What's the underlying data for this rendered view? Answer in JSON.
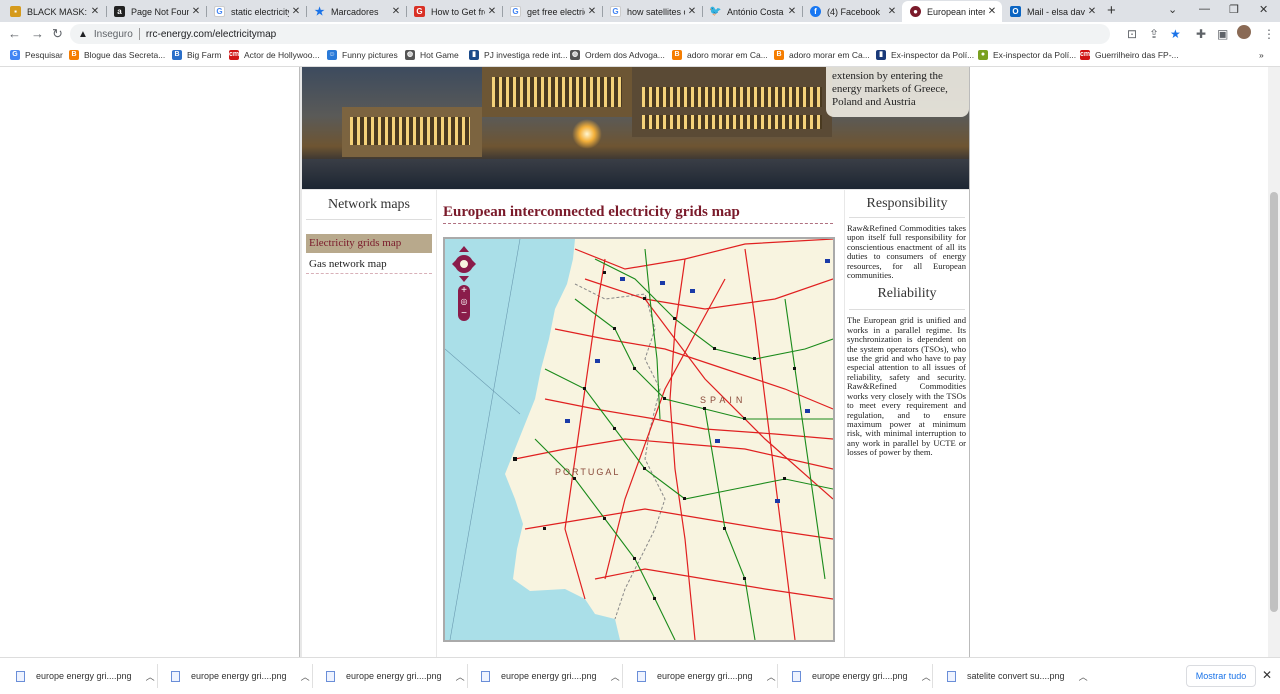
{
  "tabs": [
    {
      "title": "BLACK MASK: Su",
      "favicon": "film-icon",
      "color": "#d59a1c"
    },
    {
      "title": "Page Not Found",
      "favicon": "amazon-icon",
      "color": "#222222"
    },
    {
      "title": "static electricity",
      "favicon": "google-icon",
      "color": "#4285f4"
    },
    {
      "title": "Marcadores",
      "favicon": "star-icon",
      "color": "#1a73e8"
    },
    {
      "title": "How to Get free",
      "favicon": "red-square-icon",
      "color": "#d93025"
    },
    {
      "title": "get free electric",
      "favicon": "google-icon",
      "color": "#4285f4"
    },
    {
      "title": "how satellites co",
      "favicon": "google-icon",
      "color": "#4285f4"
    },
    {
      "title": "António Costa n",
      "favicon": "twitter-icon",
      "color": "#1d9bf0"
    },
    {
      "title": "(4) Facebook",
      "favicon": "facebook-icon",
      "color": "#1877f2"
    },
    {
      "title": "European interc",
      "favicon": "site-icon",
      "color": "#7a1a2a",
      "active": true
    },
    {
      "title": "Mail - elsa davi",
      "favicon": "outlook-icon",
      "color": "#0a64c2"
    }
  ],
  "address": {
    "security": "Inseguro",
    "url": "rrc-energy.com/electricitymap"
  },
  "bookmarks": [
    {
      "label": "Pesquisar",
      "icon": "google-icon",
      "color": "#4285f4"
    },
    {
      "label": "Blogue das Secreta...",
      "icon": "blogger-icon",
      "color": "#f57d00"
    },
    {
      "label": "Big Farm",
      "icon": "bigfarm-icon",
      "color": "#2a6fc9"
    },
    {
      "label": "Actor de Hollywoo...",
      "icon": "cm-icon",
      "color": "#d01414"
    },
    {
      "label": "Funny pictures",
      "icon": "funny-icon",
      "color": "#2a7ad8"
    },
    {
      "label": "Hot Game",
      "icon": "globe-icon",
      "color": "#555555"
    },
    {
      "label": "PJ investiga rede int...",
      "icon": "news-icon",
      "color": "#1a4a8a"
    },
    {
      "label": "Ordem dos Advoga...",
      "icon": "globe-icon",
      "color": "#555555"
    },
    {
      "label": "adoro morar em Ca...",
      "icon": "blogger-icon",
      "color": "#f57d00"
    },
    {
      "label": "adoro morar em Ca...",
      "icon": "blogger-icon",
      "color": "#f57d00"
    },
    {
      "label": "Ex-inspector da Polí...",
      "icon": "news-icon",
      "color": "#1a3a7a"
    },
    {
      "label": "Ex-inspector da Polí...",
      "icon": "frog-icon",
      "color": "#7aa020"
    },
    {
      "label": "Guerrilheiro das FP-...",
      "icon": "cm-icon",
      "color": "#d01414"
    }
  ],
  "banner": {
    "caption": "extension by entering the energy markets of Greece, Poland and Austria"
  },
  "left": {
    "title": "Network maps",
    "items": [
      {
        "label": "Electricity grids map",
        "selected": true
      },
      {
        "label": "Gas network map",
        "selected": false
      }
    ]
  },
  "center": {
    "title": "European interconnected electricity grids map",
    "map_labels": {
      "portugal": "PORTUGAL",
      "spain": "SPAIN"
    }
  },
  "right": {
    "responsibility_title": "Responsibility",
    "responsibility_text": "Raw&Refined Commodities takes upon itself full responsibility for conscientious enactment of all its duties to consumers of energy resources, for all European communities.",
    "reliability_title": "Reliability",
    "reliability_text": "The European grid is unified and works in a parallel regime. Its synchronization is dependent on the system operators (TSOs), who use the grid and who have to pay especial attention to all issues of reliability, safety and security. Raw&Refined Commodities works very closely with the TSOs to meet every requirement and regulation, and to ensure maximum power at minimum risk, with minimal interruption to any work in parallel by UCTE or losses of power by them."
  },
  "downloads": {
    "items": [
      "europe energy gri....png",
      "europe energy gri....png",
      "europe energy gri....png",
      "europe energy gri....png",
      "europe energy gri....png",
      "europe energy gri....png",
      "satelite convert su....png"
    ],
    "show_all": "Mostrar tudo"
  },
  "colors": {
    "accent": "#7a1a2a",
    "sea": "#aadfe8",
    "land": "#f8f4e0",
    "line_red": "#e02020",
    "line_green": "#1a8a1a"
  }
}
